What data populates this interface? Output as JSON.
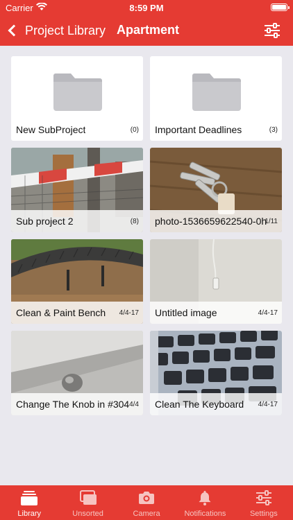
{
  "status_bar": {
    "carrier": "Carrier",
    "time": "8:59 PM"
  },
  "nav": {
    "back_label": "Project Library",
    "title": "Apartment"
  },
  "tiles": [
    {
      "name": "New SubProject",
      "meta": "(0)",
      "kind": "folder"
    },
    {
      "name": "Important Deadlines",
      "meta": "(3)",
      "kind": "folder"
    },
    {
      "name": "Sub project 2",
      "meta": "(8)",
      "kind": "subproject"
    },
    {
      "name": "photo-1536659622540-0h",
      "meta": "1/11",
      "kind": "photo"
    },
    {
      "name": "Clean & Paint Bench",
      "meta": "4/4-17",
      "kind": "photo"
    },
    {
      "name": "Untitled image",
      "meta": "4/4-17",
      "kind": "photo"
    },
    {
      "name": "Change The Knob in #304",
      "meta": "4/4",
      "kind": "photo"
    },
    {
      "name": "Clean The Keyboard",
      "meta": "4/4-17",
      "kind": "photo"
    }
  ],
  "tabs": [
    {
      "label": "Library",
      "icon": "library-icon",
      "active": true
    },
    {
      "label": "Unsorted",
      "icon": "unsorted-icon",
      "active": false
    },
    {
      "label": "Camera",
      "icon": "camera-icon",
      "active": false
    },
    {
      "label": "Notifications",
      "icon": "bell-icon",
      "active": false
    },
    {
      "label": "Settings",
      "icon": "sliders-icon",
      "active": false
    }
  ],
  "colors": {
    "brand": "#e53b33",
    "background": "#e9e8ee",
    "folder": "#c8c8cc"
  }
}
